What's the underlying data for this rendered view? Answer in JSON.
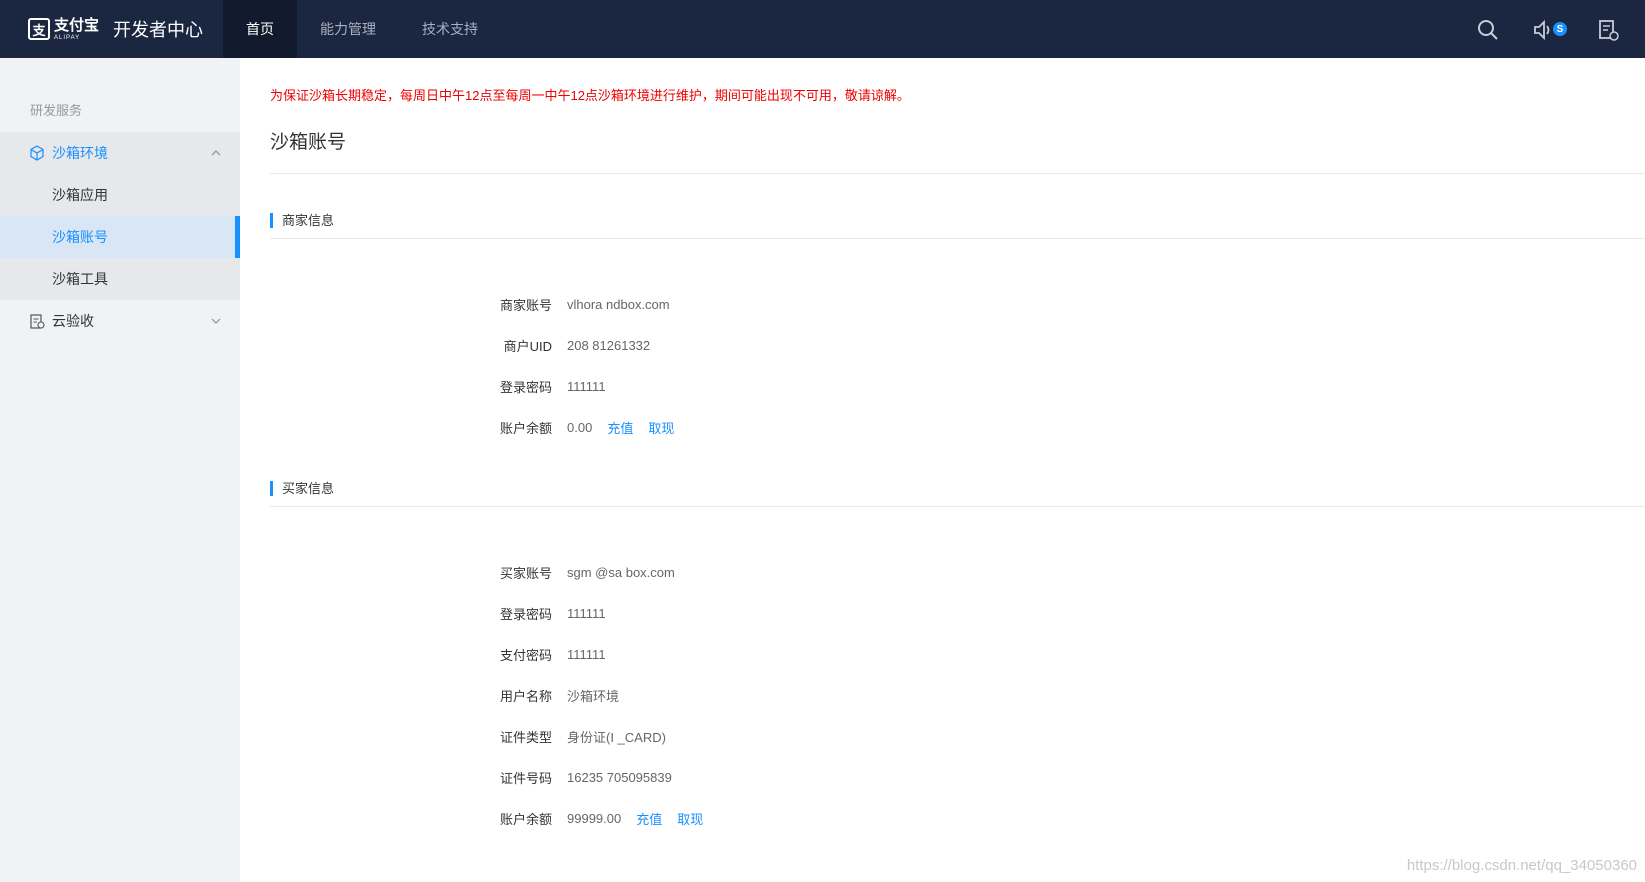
{
  "header": {
    "brand_cn": "支付宝",
    "brand_en": "ALIPAY",
    "title": "开发者中心",
    "nav": [
      "首页",
      "能力管理",
      "技术支持"
    ],
    "badge": "S"
  },
  "sidebar": {
    "group_title": "研发服务",
    "items": [
      {
        "label": "沙箱环境"
      },
      {
        "label": "沙箱应用"
      },
      {
        "label": "沙箱账号"
      },
      {
        "label": "沙箱工具"
      },
      {
        "label": "云验收"
      }
    ]
  },
  "main": {
    "notice": "为保证沙箱长期稳定，每周日中午12点至每周一中午12点沙箱环境进行维护，期间可能出现不可用，敬请谅解。",
    "page_title": "沙箱账号",
    "merchant": {
      "section_title": "商家信息",
      "rows": [
        {
          "key": "商家账号",
          "value": "vlhora        ndbox.com"
        },
        {
          "key": "商户UID",
          "value": "208        81261332"
        },
        {
          "key": "登录密码",
          "value": "111111"
        },
        {
          "key": "账户余额",
          "value": "0.00"
        }
      ],
      "recharge": "充值",
      "withdraw": "取现"
    },
    "buyer": {
      "section_title": "买家信息",
      "rows": [
        {
          "key": "买家账号",
          "value": "sgm         @sa    box.com"
        },
        {
          "key": "登录密码",
          "value": "111111"
        },
        {
          "key": "支付密码",
          "value": "111111"
        },
        {
          "key": "用户名称",
          "value": "沙箱环境"
        },
        {
          "key": "证件类型",
          "value": "身份证(I          _CARD)"
        },
        {
          "key": "证件号码",
          "value": "16235       705095839"
        },
        {
          "key": "账户余额",
          "value": "99999.00"
        }
      ],
      "recharge": "充值",
      "withdraw": "取现"
    }
  },
  "watermark": "https://blog.csdn.net/qq_34050360",
  "colors": {
    "topbar": "#1b2640",
    "accent": "#1890ff",
    "notice": "#ee0000"
  }
}
